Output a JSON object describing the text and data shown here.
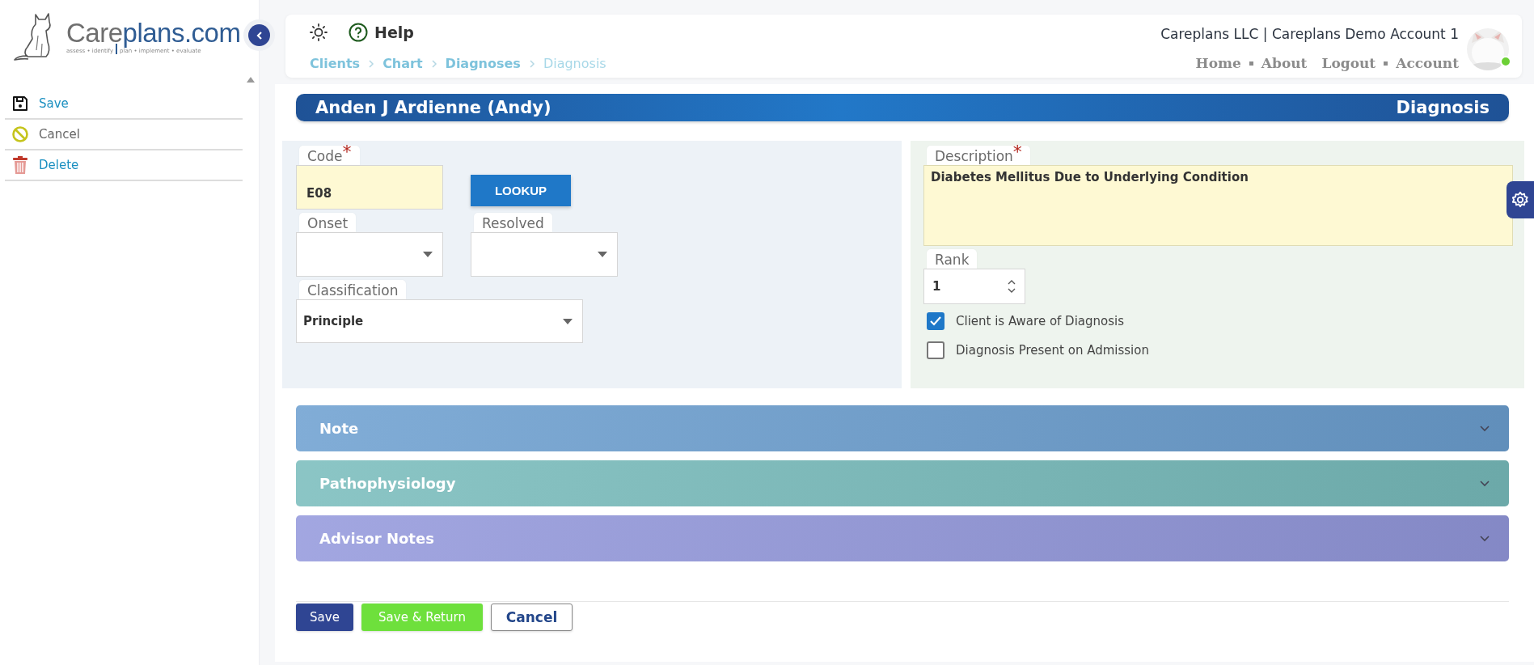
{
  "sidebar": {
    "logo": {
      "title_parts": [
        "Care",
        "plans.com"
      ],
      "tagline_parts": [
        "assess • identify",
        "plan • implement • evaluate"
      ]
    },
    "actions": [
      {
        "kind": "save",
        "label": "Save"
      },
      {
        "kind": "cancel",
        "label": "Cancel"
      },
      {
        "kind": "delete",
        "label": "Delete"
      }
    ]
  },
  "header": {
    "help_label": "Help",
    "breadcrumbs": [
      {
        "label": "Clients",
        "current": false
      },
      {
        "label": "Chart",
        "current": false
      },
      {
        "label": "Diagnoses",
        "current": false
      },
      {
        "label": "Diagnosis",
        "current": true
      }
    ],
    "account": "Careplans LLC | Careplans Demo Account 1",
    "nav": [
      {
        "label": "Home",
        "dot_before": false
      },
      {
        "label": "About",
        "dot_before": true
      },
      {
        "label": "Logout",
        "dot_before": false
      },
      {
        "label": "Account",
        "dot_before": true
      }
    ],
    "avatar": {
      "online": true
    }
  },
  "title_bar": {
    "client": "Anden J Ardienne (Andy)",
    "page": "Diagnosis"
  },
  "form": {
    "code": {
      "label": "Code",
      "required_mark": "*",
      "value": "E08"
    },
    "lookup_button": "LOOKUP",
    "onset": {
      "label": "Onset"
    },
    "resolved": {
      "label": "Resolved"
    },
    "classification": {
      "label": "Classification",
      "value": "Principle"
    },
    "description": {
      "label": "Description",
      "required_mark": "*",
      "value": "Diabetes Mellitus Due to Underlying Condition"
    },
    "rank": {
      "label": "Rank",
      "value": "1"
    },
    "checkboxes": [
      {
        "label": "Client is Aware of Diagnosis",
        "checked": true
      },
      {
        "label": "Diagnosis Present on Admission",
        "checked": false
      }
    ]
  },
  "accordions": [
    {
      "title": "Note",
      "expanded": false,
      "color": "#6c9fd0"
    },
    {
      "title": "Pathophysiology",
      "expanded": false,
      "color": "#78bcbc"
    },
    {
      "title": "Advisor Notes",
      "expanded": false,
      "color": "#9398dc"
    }
  ],
  "footer_buttons": [
    {
      "kind": "primary",
      "label": "Save"
    },
    {
      "kind": "success",
      "label": "Save & Return"
    },
    {
      "kind": "outline",
      "label": "Cancel"
    }
  ]
}
